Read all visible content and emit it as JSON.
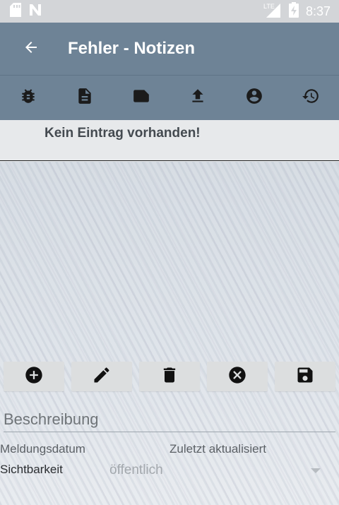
{
  "status_bar": {
    "time": "8:37",
    "network": "LTE"
  },
  "app_bar": {
    "title": "Fehler - Notizen",
    "back_icon": "arrow-left-icon"
  },
  "toolbar": {
    "icons": [
      "bug-icon",
      "document-icon",
      "note-icon",
      "upload-icon",
      "account-icon",
      "history-icon"
    ]
  },
  "empty_state": {
    "text": "Kein Eintrag vorhanden!"
  },
  "actions": {
    "icons": [
      "add-icon",
      "edit-icon",
      "delete-icon",
      "cancel-icon",
      "save-icon"
    ]
  },
  "form": {
    "description_placeholder": "Beschreibung",
    "description_value": "",
    "report_date_label": "Meldungsdatum",
    "updated_label": "Zuletzt aktualisiert",
    "visibility_label": "Sichtbarkeit",
    "visibility_value": "öffentlich"
  },
  "colors": {
    "app_bar": "#6e8396",
    "status_bar": "#d3d5d8",
    "button_bg": "#dcdedf"
  }
}
